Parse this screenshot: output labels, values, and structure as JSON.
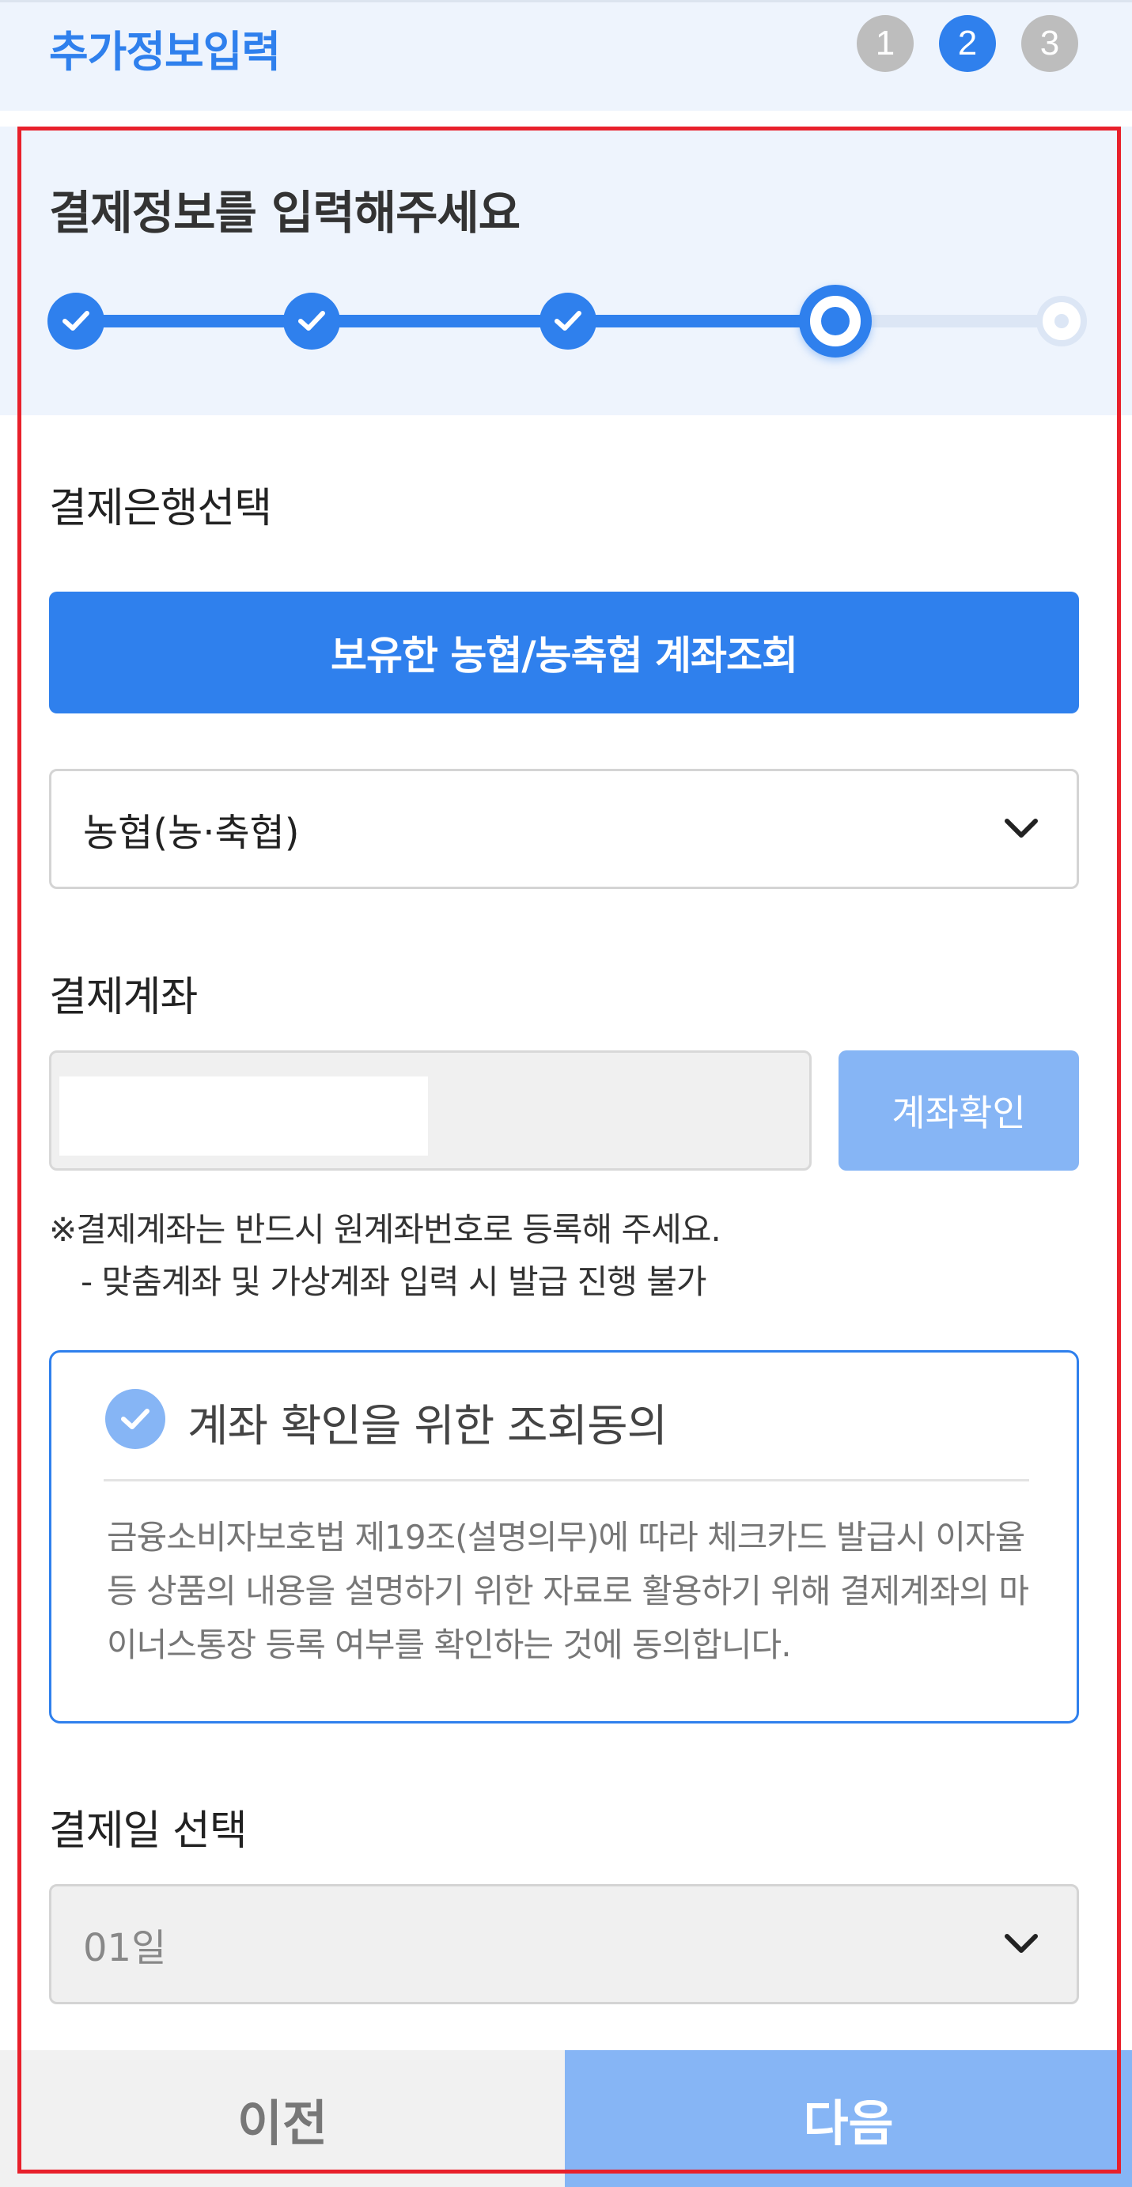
{
  "header": {
    "title": "추가정보입력",
    "steps": [
      "1",
      "2",
      "3"
    ],
    "active_step": 2
  },
  "progress": {
    "heading": "결제정보를 입력해주세요",
    "total_steps": 5,
    "completed_steps": 3,
    "current_step": 4
  },
  "bank": {
    "label": "결제은행선택",
    "lookup_button": "보유한 농협/농축협 계좌조회",
    "selected": "농협(농·축협)"
  },
  "account": {
    "label": "결제계좌",
    "confirm_button": "계좌확인",
    "notice_line1": "※결제계좌는 반드시 원계좌번호로 등록해 주세요.",
    "notice_line2": "- 맞춤계좌 및 가상계좌 입력 시 발급 진행 불가"
  },
  "consent": {
    "title": "계좌 확인을 위한 조회동의",
    "body": "금융소비자보호법 제19조(설명의무)에 따라 체크카드 발급시 이자율 등 상품의 내용을 설명하기 위한 자료로 활용하기 위해 결제계좌의 마이너스통장 등록 여부를 확인하는 것에 동의합니다.",
    "checked": true
  },
  "payment_day": {
    "label": "결제일 선택",
    "selected": "01일"
  },
  "footer": {
    "prev_label": "이전",
    "next_label": "다음"
  },
  "colors": {
    "primary": "#2f80ed",
    "primary_light": "#86b5f5",
    "highlight_frame": "#e8202b"
  }
}
